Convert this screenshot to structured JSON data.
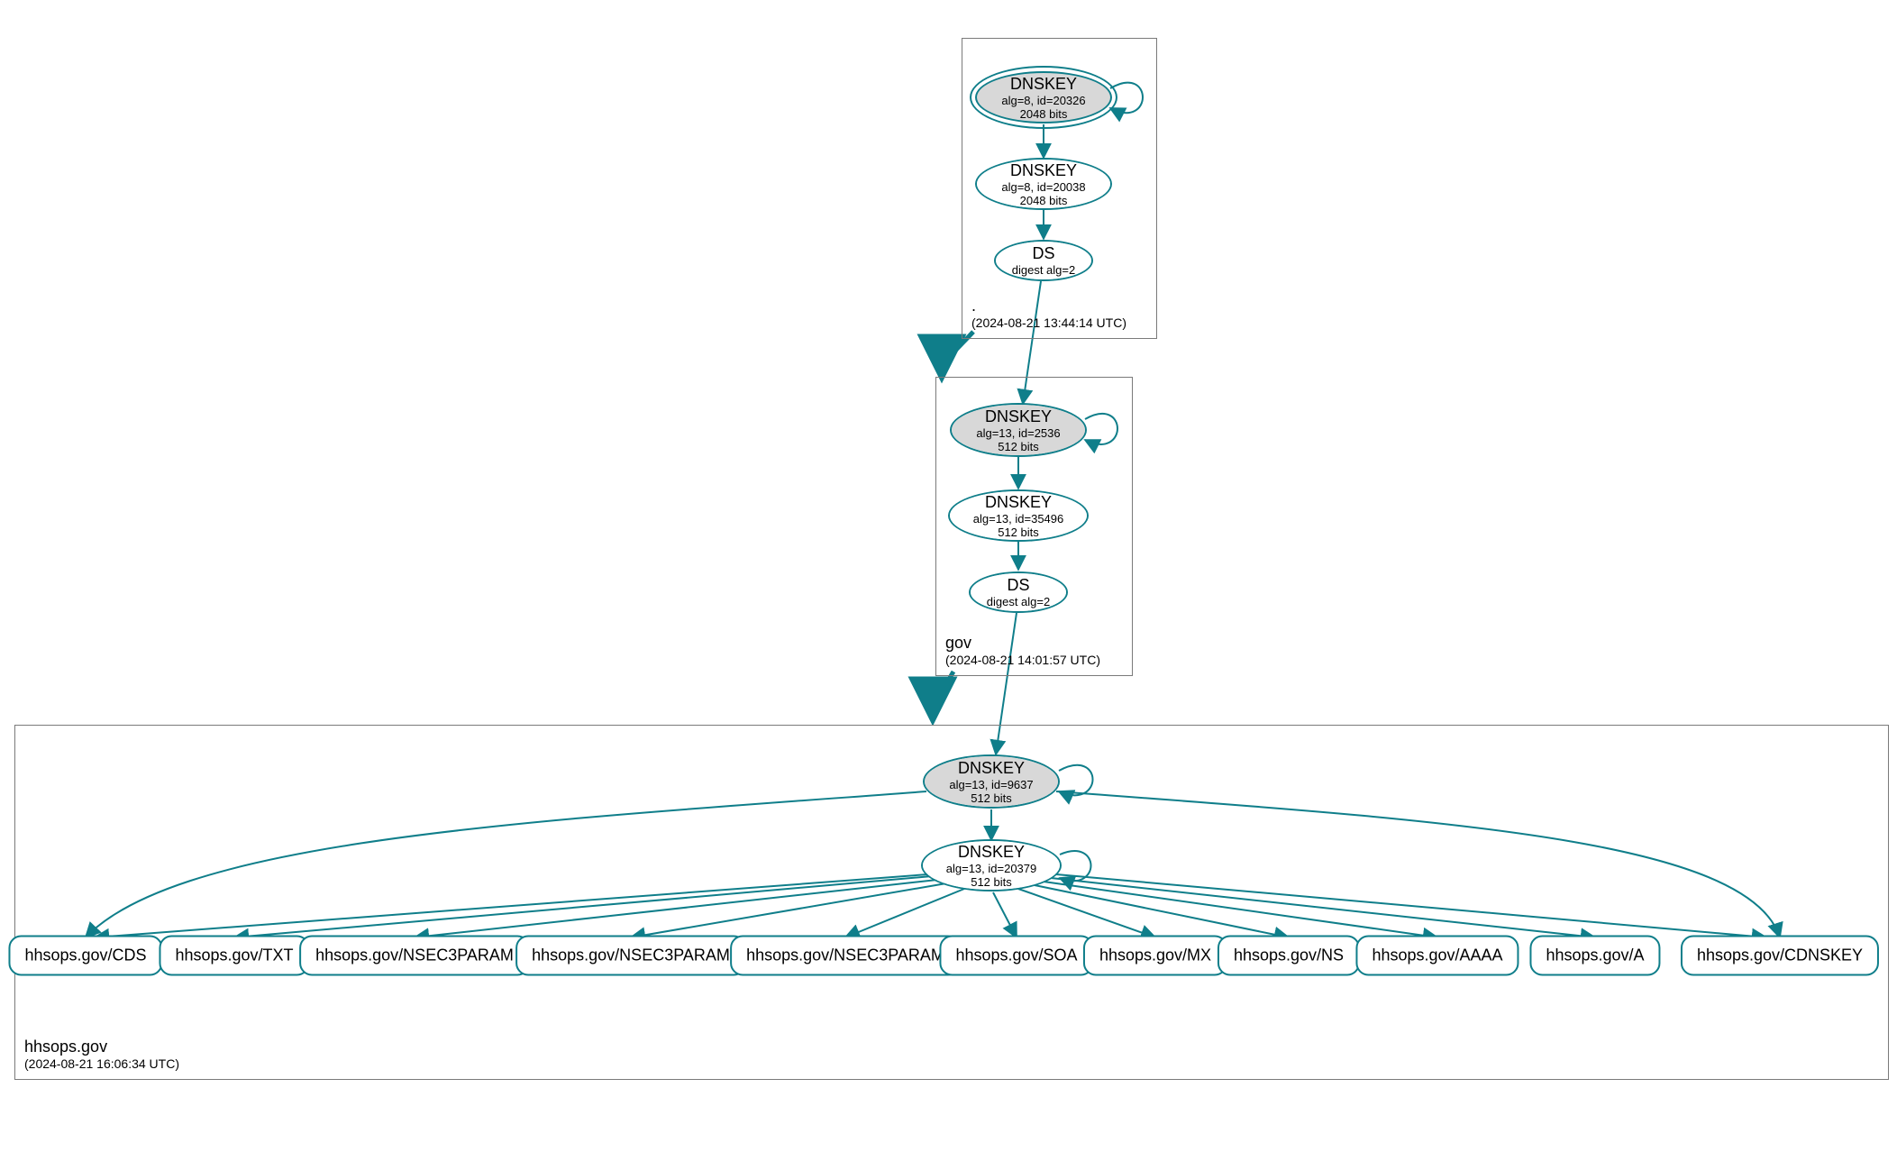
{
  "colors": {
    "stroke": "#0f7e8a",
    "ksk_fill": "#d8d8d8",
    "zsk_fill": "#ffffff",
    "box_border": "#7a7a7a"
  },
  "zones": {
    "root": {
      "name": ".",
      "timestamp": "(2024-08-21 13:44:14 UTC)"
    },
    "gov": {
      "name": "gov",
      "timestamp": "(2024-08-21 14:01:57 UTC)"
    },
    "hhsops": {
      "name": "hhsops.gov",
      "timestamp": "(2024-08-21 16:06:34 UTC)"
    }
  },
  "nodes": {
    "root_ksk": {
      "title": "DNSKEY",
      "line2": "alg=8, id=20326",
      "line3": "2048 bits"
    },
    "root_zsk": {
      "title": "DNSKEY",
      "line2": "alg=8, id=20038",
      "line3": "2048 bits"
    },
    "root_ds": {
      "title": "DS",
      "line2": "digest alg=2"
    },
    "gov_ksk": {
      "title": "DNSKEY",
      "line2": "alg=13, id=2536",
      "line3": "512 bits"
    },
    "gov_zsk": {
      "title": "DNSKEY",
      "line2": "alg=13, id=35496",
      "line3": "512 bits"
    },
    "gov_ds": {
      "title": "DS",
      "line2": "digest alg=2"
    },
    "hhsops_ksk": {
      "title": "DNSKEY",
      "line2": "alg=13, id=9637",
      "line3": "512 bits"
    },
    "hhsops_zsk": {
      "title": "DNSKEY",
      "line2": "alg=13, id=20379",
      "line3": "512 bits"
    }
  },
  "records": {
    "cds": "hhsops.gov/CDS",
    "txt": "hhsops.gov/TXT",
    "n3p1": "hhsops.gov/NSEC3PARAM",
    "n3p2": "hhsops.gov/NSEC3PARAM",
    "n3p3": "hhsops.gov/NSEC3PARAM",
    "soa": "hhsops.gov/SOA",
    "mx": "hhsops.gov/MX",
    "ns": "hhsops.gov/NS",
    "aaaa": "hhsops.gov/AAAA",
    "a": "hhsops.gov/A",
    "cdnskey": "hhsops.gov/CDNSKEY"
  }
}
